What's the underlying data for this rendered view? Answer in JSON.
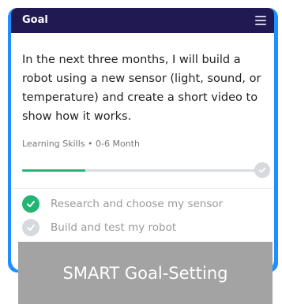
{
  "header": {
    "title": "Goal",
    "menu_icon": "hamburger-menu-icon"
  },
  "goal": {
    "text": "In the next three months, I will build a robot using a new sensor (light, sound, or temperature) and create a short video to show how it works.",
    "meta": "Learning Skills • 0-6 Month",
    "progress": 0.27
  },
  "tasks": [
    {
      "label": "Research and choose my sensor",
      "done": true
    },
    {
      "label": "Build and test my robot",
      "done": false
    }
  ],
  "caption": "SMART Goal-Setting",
  "colors": {
    "accent_frame": "#1f8fff",
    "header_bg": "#211a52",
    "progress_done": "#22b573",
    "progress_track": "#d9dde0",
    "caption_bg": "#a3a3a3"
  }
}
